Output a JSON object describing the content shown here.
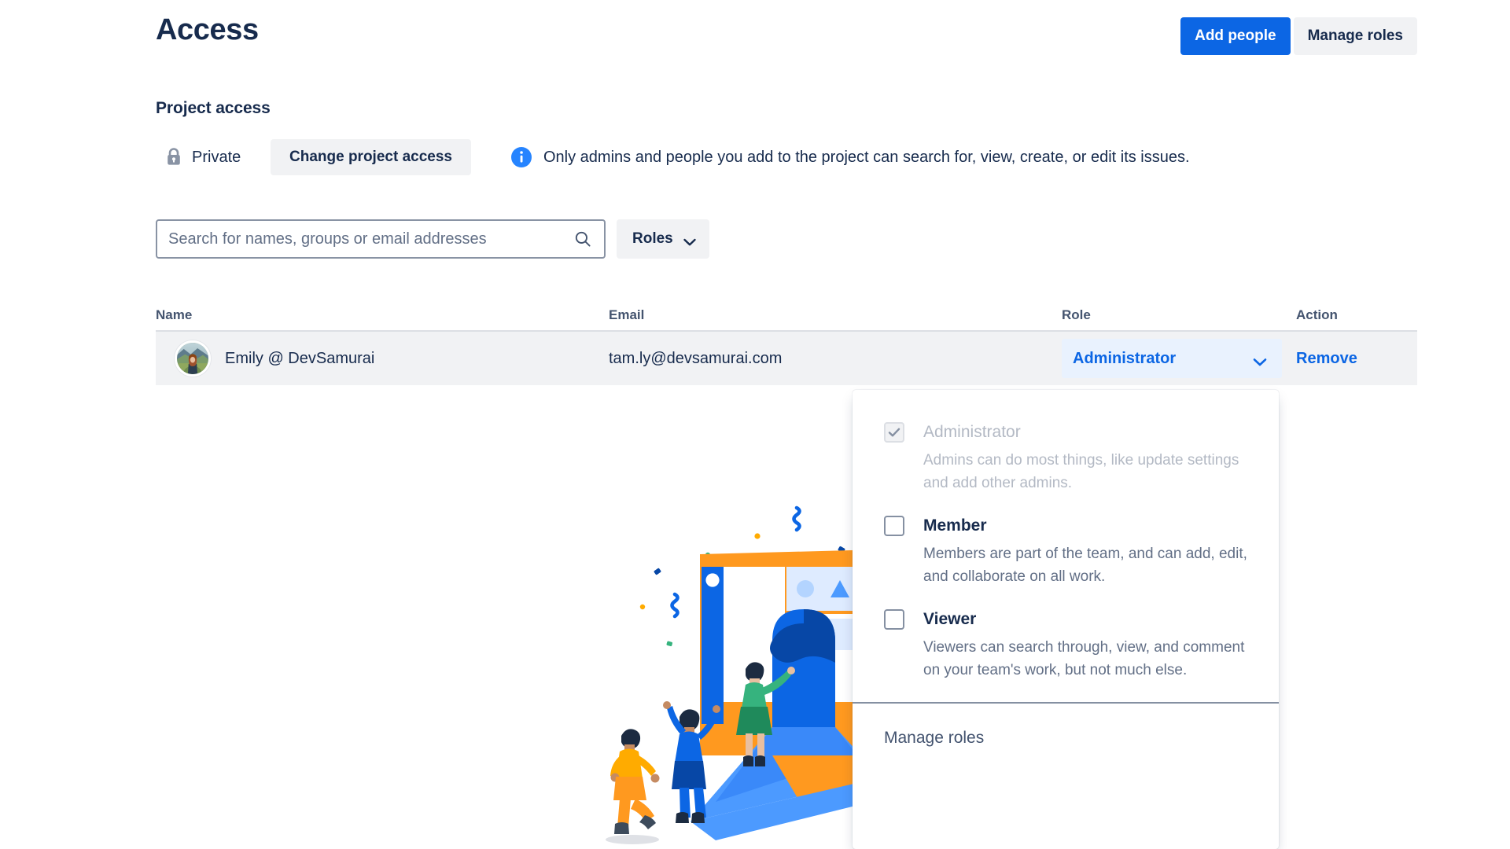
{
  "header": {
    "title": "Access",
    "add_people_label": "Add people",
    "manage_roles_label": "Manage roles",
    "primary_color": "#0C66E4",
    "subtle_bg": "#F1F2F4"
  },
  "project_access": {
    "section_title": "Project access",
    "privacy_icon": "lock-icon",
    "privacy_label": "Private",
    "change_button_label": "Change project access",
    "info_icon": "info-circle-icon",
    "info_color": "#2684FF",
    "info_text": "Only admins and people you add to the project can search for, view, create, or edit its issues."
  },
  "filters": {
    "search_icon": "search-icon",
    "search_placeholder": "Search for names, groups or email addresses",
    "search_value": "",
    "roles_button_label": "Roles",
    "roles_chevron_icon": "chevron-down-icon"
  },
  "table": {
    "columns": [
      "Name",
      "Email",
      "Role",
      "Action"
    ],
    "rows": [
      {
        "avatar": "user-avatar-photo",
        "name": "Emily @ DevSamurai",
        "email": "tam.ly@devsamurai.com",
        "role": "Administrator",
        "role_chevron_icon": "chevron-down-icon",
        "action": "Remove"
      }
    ]
  },
  "role_dropdown": {
    "options": [
      {
        "label": "Administrator",
        "description": "Admins can do most things, like update settings and add other admins.",
        "checked": true,
        "disabled": true
      },
      {
        "label": "Member",
        "description": "Members are part of the team, and can add, edit, and collaborate on all work.",
        "checked": false,
        "disabled": false
      },
      {
        "label": "Viewer",
        "description": "Viewers can search through, view, and comment on your team's work, but not much else.",
        "checked": false,
        "disabled": false
      }
    ],
    "footer_label": "Manage roles"
  },
  "illustration": {
    "name": "team-collaboration-empty-state-illustration",
    "colors": {
      "orange": "#FF991F",
      "blue": "#0C66E4",
      "light_blue": "#4C9AFF",
      "dark_blue": "#0747A6",
      "green": "#36B37E",
      "yellow": "#FFAB00"
    }
  }
}
